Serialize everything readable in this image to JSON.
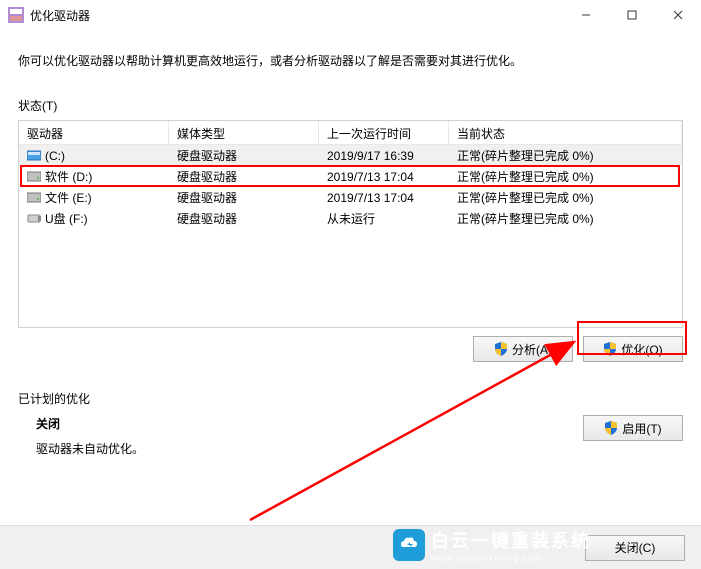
{
  "window": {
    "title": "优化驱动器"
  },
  "description": "你可以优化驱动器以帮助计算机更高效地运行，或者分析驱动器以了解是否需要对其进行优化。",
  "status_label": "状态(T)",
  "columns": {
    "drive": "驱动器",
    "media": "媒体类型",
    "last": "上一次运行时间",
    "status": "当前状态"
  },
  "drives": [
    {
      "icon": "os",
      "name": "(C:)",
      "media": "硬盘驱动器",
      "last": "2019/9/17 16:39",
      "status": "正常(碎片整理已完成 0%)",
      "selected": true
    },
    {
      "icon": "hdd",
      "name": "软件 (D:)",
      "media": "硬盘驱动器",
      "last": "2019/7/13 17:04",
      "status": "正常(碎片整理已完成 0%)",
      "selected": false
    },
    {
      "icon": "hdd",
      "name": "文件 (E:)",
      "media": "硬盘驱动器",
      "last": "2019/7/13 17:04",
      "status": "正常(碎片整理已完成 0%)",
      "selected": false
    },
    {
      "icon": "usb",
      "name": "U盘 (F:)",
      "media": "硬盘驱动器",
      "last": "从未运行",
      "status": "正常(碎片整理已完成 0%)",
      "selected": false
    }
  ],
  "buttons": {
    "analyze": "分析(A)",
    "optimize": "优化(O)",
    "enable": "启用(T)",
    "close": "关闭(C)"
  },
  "scheduled": {
    "label": "已计划的优化",
    "state": "关闭",
    "note": "驱动器未自动优化。"
  },
  "watermark": {
    "brand": "白云一键重装系统",
    "url": "www.baiyunxitong.com"
  }
}
